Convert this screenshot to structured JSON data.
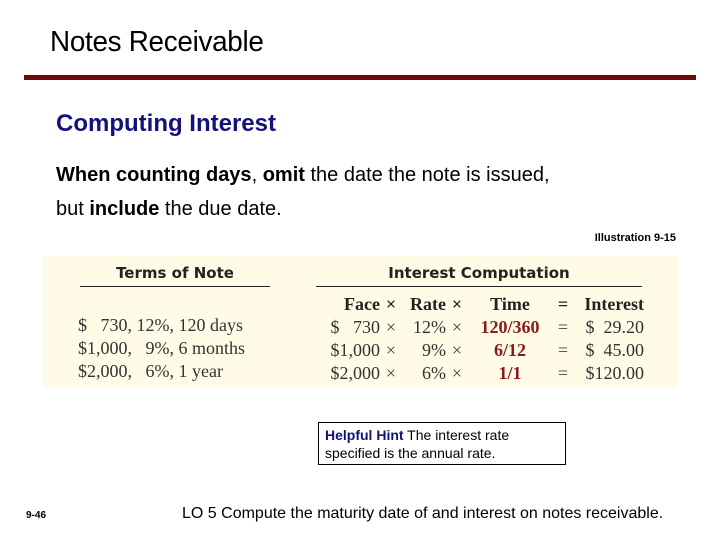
{
  "slide": {
    "title": "Notes Receivable",
    "subtitle": "Computing Interest",
    "body": {
      "part1_bold": "When counting days",
      "part2": ", ",
      "part3_bold": "omit",
      "part4": " the date the note is issued,",
      "part5": "but ",
      "part6_bold": "include",
      "part7": " the due date."
    },
    "illustration_label": "Illustration 9-15",
    "colors": {
      "title_rule": "#6b0a0e",
      "subtitle": "#12127a",
      "panel_background": "#fffbe6",
      "time_values": "#8b1a1a"
    }
  },
  "terms_of_note": {
    "header": "Terms of Note",
    "rows": [
      "$   730, 12%, 120 days",
      "$1,000,   9%, 6 months",
      "$2,000,   6%, 1 year"
    ]
  },
  "interest_computation": {
    "header": "Interest Computation",
    "columns": {
      "face": "Face",
      "times1": "×",
      "rate": "Rate",
      "times2": "×",
      "time": "Time",
      "equals": "=",
      "interest": "Interest"
    },
    "rows": [
      {
        "face": "$   730",
        "op1": "×",
        "rate": "12%",
        "op2": "×",
        "time": "120/360",
        "eq": "=",
        "interest": "$  29.20"
      },
      {
        "face": "$1,000",
        "op1": "×",
        "rate": "9%",
        "op2": "×",
        "time": "6/12",
        "eq": "=",
        "interest": "$  45.00"
      },
      {
        "face": "$2,000",
        "op1": "×",
        "rate": "6%",
        "op2": "×",
        "time": "1/1",
        "eq": "=",
        "interest": "$120.00"
      }
    ]
  },
  "hint": {
    "title": "Helpful Hint",
    "text": " The interest rate specified is the annual rate."
  },
  "footer": {
    "page_number": "9-46",
    "learning_objective": "LO 5  Compute the maturity date of and interest on notes receivable."
  }
}
